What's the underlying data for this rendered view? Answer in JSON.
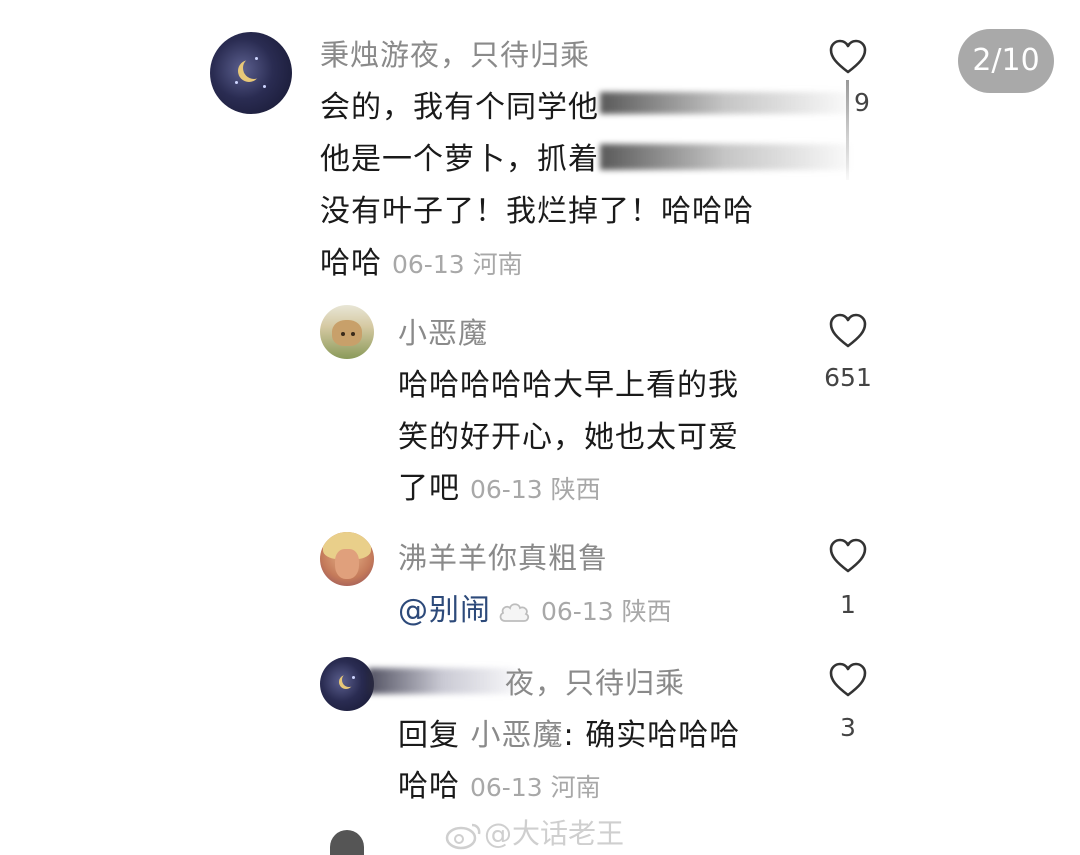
{
  "pager": {
    "label": "2/10"
  },
  "comments": [
    {
      "username": "秉烛游夜，只待归乘",
      "lines": [
        "会的，我有个同学他",
        "他是一个萝卜，抓着",
        "没有叶子了！我烂掉了！哈哈哈"
      ],
      "last_line": "哈哈",
      "date": "06-13",
      "location": "河南",
      "like_count": "9"
    },
    {
      "username": "小恶魔",
      "lines": [
        "哈哈哈哈哈大早上看的我",
        "笑的好开心，她也太可爱"
      ],
      "last_line": "了吧",
      "date": "06-13",
      "location": "陕西",
      "like_count": "651"
    },
    {
      "username": "沸羊羊你真粗鲁",
      "mention": "@别闹",
      "date": "06-13",
      "location": "陕西",
      "like_count": "1"
    },
    {
      "username_visible": "夜，只待归乘",
      "reply_prefix": "回复",
      "reply_to": "小恶魔",
      "reply_text": ": 确实哈哈哈",
      "last_line": "哈哈",
      "date": "06-13",
      "location": "河南",
      "like_count": "3"
    }
  ],
  "watermark": "@大话老王",
  "icons": {
    "like": "heart-outline-icon",
    "sticker": "cloud-sticker-icon",
    "weibo": "weibo-logo-icon"
  },
  "colors": {
    "text": "#1a1a1a",
    "username": "#8a8a8a",
    "meta": "#a8a8a8",
    "mention": "#2d4a7a",
    "badge_bg": "#a9a9a9"
  }
}
